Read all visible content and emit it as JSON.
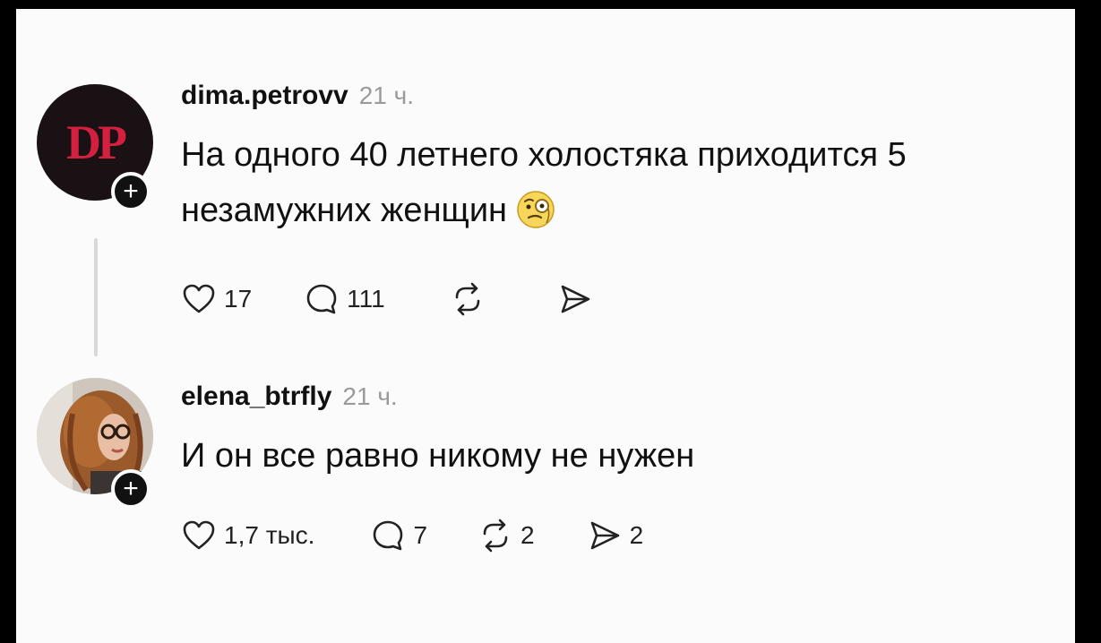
{
  "posts": [
    {
      "avatar_text": "DP",
      "avatar_color": "#d4203f",
      "username": "dima.petrovv",
      "time": "21 ч.",
      "text": "На одного 40 летнего холостяка приходится 5 незамужних женщин",
      "emoji": "face-with-monocle",
      "likes": "17",
      "replies": "111",
      "reposts": "",
      "shares": ""
    },
    {
      "username": "elena_btrfly",
      "time": "21 ч.",
      "text": "И он все равно никому не нужен",
      "likes": "1,7 тыс.",
      "replies": "7",
      "reposts": "2",
      "shares": "2"
    }
  ],
  "icons": {
    "like": "heart-icon",
    "reply": "comment-icon",
    "repost": "repost-icon",
    "share": "send-icon",
    "follow": "plus-icon"
  }
}
